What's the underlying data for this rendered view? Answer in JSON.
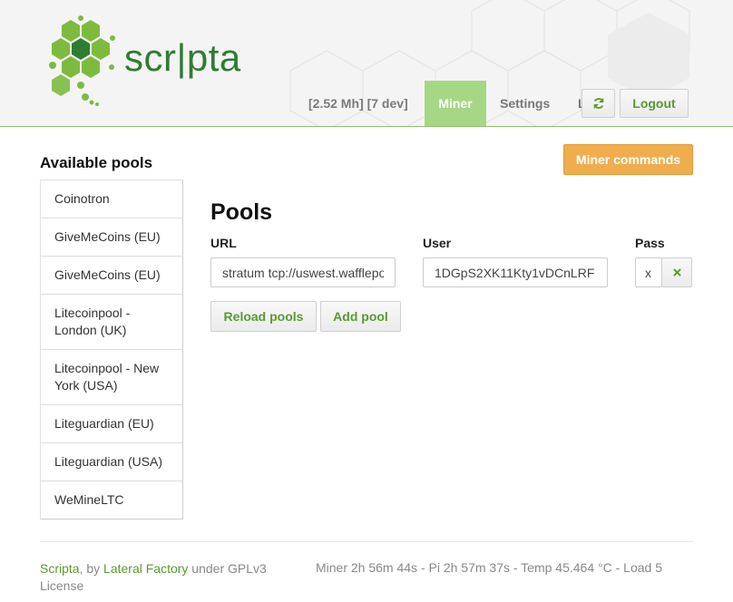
{
  "brand": "scr|pta",
  "header": {
    "hashrate": "[2.52 Mh] [7 dev]",
    "nav": {
      "miner": "Miner",
      "settings": "Settings",
      "partial": "L"
    },
    "logout": "Logout"
  },
  "sidebar": {
    "title": "Available pools",
    "pools": [
      "Coinotron",
      "GiveMeCoins (EU)",
      "GiveMeCoins (EU)",
      "Litecoinpool - London (UK)",
      "Litecoinpool - New York (USA)",
      "Liteguardian (EU)",
      "Liteguardian (USA)",
      "WeMineLTC"
    ]
  },
  "main": {
    "commands_button": "Miner commands",
    "title": "Pools",
    "columns": {
      "url": "URL",
      "user": "User",
      "pass": "Pass"
    },
    "row": {
      "url": "stratum tcp://uswest.wafflepool.com",
      "user": "1DGpS2XK11Kty1vDCnLRF",
      "pass": "x"
    },
    "reload_button": "Reload pools",
    "add_button": "Add pool"
  },
  "footer": {
    "scripta_link": "Scripta",
    "by": ", by ",
    "lateral_link": "Lateral Factory",
    "license": " under GPLv3 License",
    "stats": "Miner 2h 56m 44s  -  Pi 2h 57m 37s  -  Temp 45.464 °C  -  Load 5"
  },
  "colors": {
    "accent": "#a6d785",
    "brand": "#2e7d32",
    "link": "#5a9a2f",
    "warning": "#f0ad4e"
  }
}
